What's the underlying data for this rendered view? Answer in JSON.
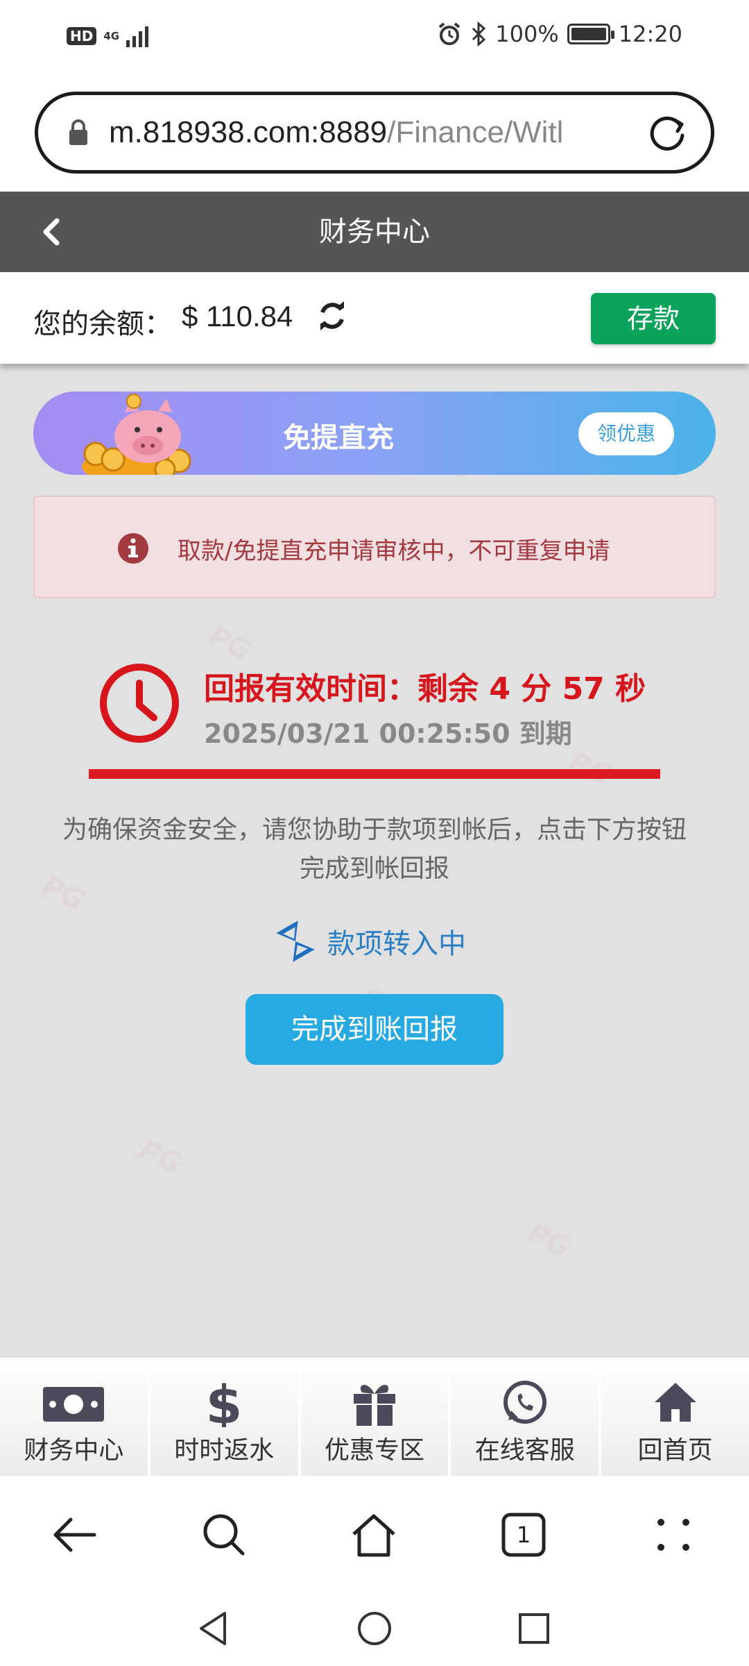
{
  "status_bar": {
    "left_badge": "HD",
    "network": "4G",
    "battery": "100%",
    "time": "12:20"
  },
  "browser": {
    "url_host": "m.818938.com:8889",
    "url_path": "/Finance/Witl"
  },
  "header": {
    "title": "财务中心"
  },
  "balance": {
    "label": "您的余额：",
    "value": "$ 110.84",
    "deposit_label": "存款"
  },
  "promo": {
    "title": "免提直充",
    "button": "领优惠"
  },
  "alert": {
    "text": "取款/免提直充申请审核中，不可重复申请"
  },
  "timer": {
    "title": "回报有效时间：剩余 4 分 57 秒",
    "expiry": "2025/03/21 00:25:50 到期"
  },
  "notice": {
    "line1": "为确保资金安全，请您协助于款项到帐后，点击下方按钮",
    "line2": "完成到帐回报"
  },
  "transfer": {
    "text": "款项转入中"
  },
  "confirm_button": "完成到账回报",
  "bottom_nav": [
    {
      "label": "财务中心",
      "icon": "money-icon"
    },
    {
      "label": "时时返水",
      "icon": "dollar-icon"
    },
    {
      "label": "优惠专区",
      "icon": "gift-icon"
    },
    {
      "label": "在线客服",
      "icon": "whatsapp-icon"
    },
    {
      "label": "回首页",
      "icon": "home-icon"
    }
  ],
  "browser_toolbar": {
    "tab_count": "1"
  },
  "colors": {
    "header": "#555555",
    "deposit": "#0aa35c",
    "alert_text": "#a33a3f",
    "timer_red": "#d7151d",
    "confirm": "#27a9e1"
  }
}
